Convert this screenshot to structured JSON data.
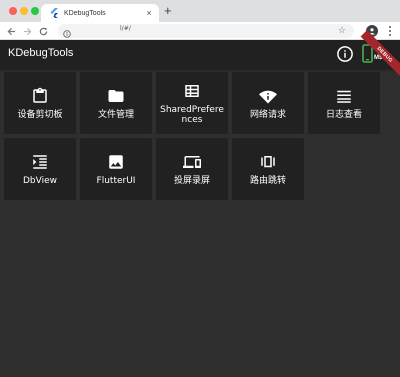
{
  "browser": {
    "tab_title": "KDebugTools",
    "tab_close": "×",
    "new_tab": "+",
    "url": "l/#/"
  },
  "appbar": {
    "title": "KDebugTools",
    "phone_label": "M$$0"
  },
  "debug_banner": "DEBUG",
  "tools": [
    {
      "label": "设备剪切板",
      "icon": "clipboard-icon"
    },
    {
      "label": "文件管理",
      "icon": "folder-icon"
    },
    {
      "label": "SharedPreferences",
      "icon": "table-icon"
    },
    {
      "label": "网络请求",
      "icon": "wifi-icon"
    },
    {
      "label": "日志查看",
      "icon": "menu-lines-icon"
    },
    {
      "label": "DbView",
      "icon": "indent-list-icon"
    },
    {
      "label": "FlutterUI",
      "icon": "image-icon"
    },
    {
      "label": "投屏录屏",
      "icon": "devices-icon"
    },
    {
      "label": "路由跳转",
      "icon": "view-carousel-icon"
    }
  ],
  "colors": {
    "background": "#2f2f2f",
    "tile": "#212121",
    "appbar": "#212121",
    "debug_banner": "#a4262c"
  }
}
